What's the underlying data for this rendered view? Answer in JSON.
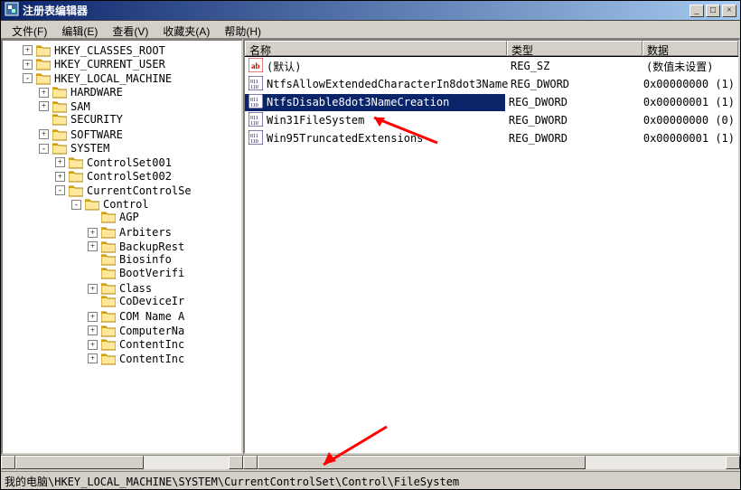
{
  "title": "注册表编辑器",
  "menu": {
    "file": "文件(F)",
    "edit": "编辑(E)",
    "view": "查看(V)",
    "favorites": "收藏夹(A)",
    "help": "帮助(H)"
  },
  "winctrl": {
    "min": "_",
    "max": "□",
    "close": "×"
  },
  "list_header": {
    "name": "名称",
    "type": "类型",
    "data": "数据"
  },
  "values": [
    {
      "icon": "string",
      "name": "(默认)",
      "type": "REG_SZ",
      "data": "(数值未设置)",
      "selected": false
    },
    {
      "icon": "binary",
      "name": "NtfsAllowExtendedCharacterIn8dot3Name",
      "type": "REG_DWORD",
      "data": "0x00000000 (1)",
      "selected": false
    },
    {
      "icon": "binary",
      "name": "NtfsDisable8dot3NameCreation",
      "type": "REG_DWORD",
      "data": "0x00000001 (1)",
      "selected": true
    },
    {
      "icon": "binary",
      "name": "Win31FileSystem",
      "type": "REG_DWORD",
      "data": "0x00000000 (0)",
      "selected": false
    },
    {
      "icon": "binary",
      "name": "Win95TruncatedExtensions",
      "type": "REG_DWORD",
      "data": "0x00000001 (1)",
      "selected": false
    }
  ],
  "tree": [
    {
      "exp": "+",
      "label": "HKEY_CLASSES_ROOT",
      "depth": 1
    },
    {
      "exp": "+",
      "label": "HKEY_CURRENT_USER",
      "depth": 1
    },
    {
      "exp": "-",
      "label": "HKEY_LOCAL_MACHINE",
      "depth": 1
    },
    {
      "exp": "+",
      "label": "HARDWARE",
      "depth": 2
    },
    {
      "exp": "+",
      "label": "SAM",
      "depth": 2
    },
    {
      "exp": "",
      "label": "SECURITY",
      "depth": 2
    },
    {
      "exp": "+",
      "label": "SOFTWARE",
      "depth": 2
    },
    {
      "exp": "-",
      "label": "SYSTEM",
      "depth": 2
    },
    {
      "exp": "+",
      "label": "ControlSet001",
      "depth": 3
    },
    {
      "exp": "+",
      "label": "ControlSet002",
      "depth": 3
    },
    {
      "exp": "-",
      "label": "CurrentControlSe",
      "depth": 3
    },
    {
      "exp": "-",
      "label": "Control",
      "depth": 4
    },
    {
      "exp": "",
      "label": "AGP",
      "depth": 5
    },
    {
      "exp": "+",
      "label": "Arbiters",
      "depth": 5
    },
    {
      "exp": "+",
      "label": "BackupRest",
      "depth": 5
    },
    {
      "exp": "",
      "label": "Biosinfo",
      "depth": 5
    },
    {
      "exp": "",
      "label": "BootVerifi",
      "depth": 5
    },
    {
      "exp": "+",
      "label": "Class",
      "depth": 5
    },
    {
      "exp": "",
      "label": "CoDeviceIr",
      "depth": 5
    },
    {
      "exp": "+",
      "label": "COM Name A",
      "depth": 5
    },
    {
      "exp": "+",
      "label": "ComputerNa",
      "depth": 5
    },
    {
      "exp": "+",
      "label": "ContentInc",
      "depth": 5
    },
    {
      "exp": "+",
      "label": "ContentInc",
      "depth": 5
    }
  ],
  "statusbar": "我的电脑\\HKEY_LOCAL_MACHINE\\SYSTEM\\CurrentControlSet\\Control\\FileSystem"
}
